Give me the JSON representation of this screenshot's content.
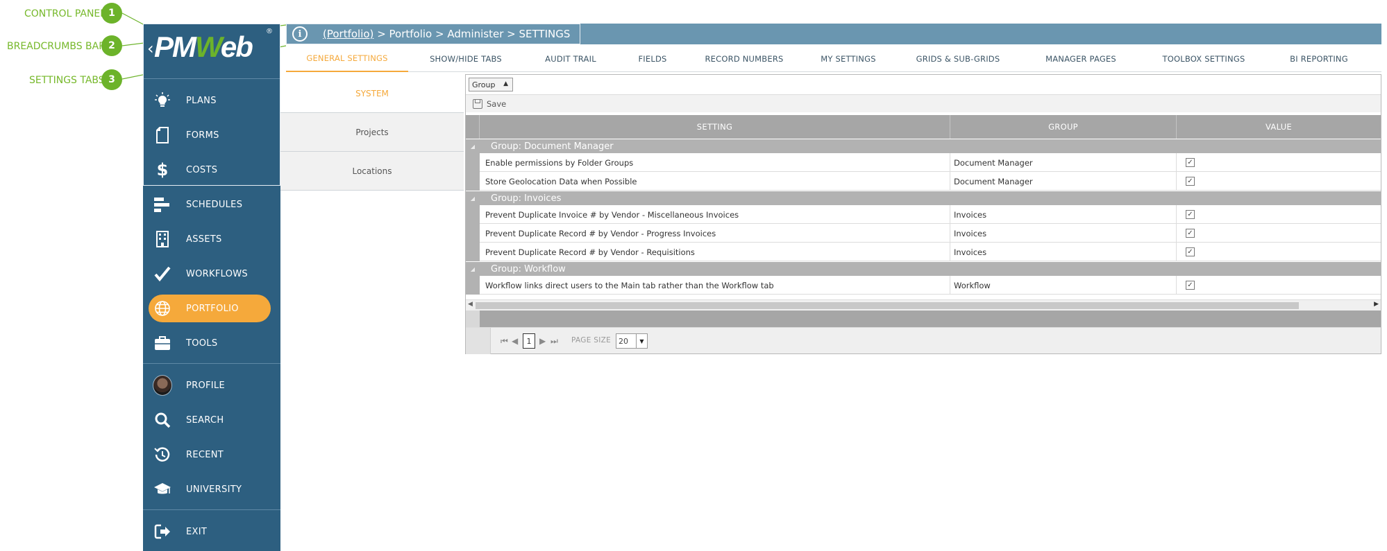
{
  "annotations": [
    {
      "num": "1",
      "label": "CONTROL PANEL"
    },
    {
      "num": "2",
      "label": "BREADCRUMBS BAR"
    },
    {
      "num": "3",
      "label": "SETTINGS TABS"
    }
  ],
  "brand": {
    "logo_pm": "PM",
    "logo_w": "W",
    "logo_eb": "eb",
    "registered": "®",
    "accent": "#f5a93b",
    "green": "#6cb32a",
    "sidebar_bg": "#2d5f80"
  },
  "sidebar": {
    "items": [
      {
        "label": "PLANS",
        "icon": "lightbulb-icon"
      },
      {
        "label": "FORMS",
        "icon": "document-icon"
      },
      {
        "label": "COSTS",
        "icon": "dollar-icon"
      },
      {
        "label": "SCHEDULES",
        "icon": "gantt-icon"
      },
      {
        "label": "ASSETS",
        "icon": "building-icon"
      },
      {
        "label": "WORKFLOWS",
        "icon": "checkmark-icon"
      },
      {
        "label": "PORTFOLIO",
        "icon": "globe-icon"
      },
      {
        "label": "TOOLS",
        "icon": "briefcase-icon"
      },
      {
        "label": "PROFILE",
        "icon": "avatar"
      },
      {
        "label": "SEARCH",
        "icon": "search-icon"
      },
      {
        "label": "RECENT",
        "icon": "history-icon"
      },
      {
        "label": "UNIVERSITY",
        "icon": "graduation-cap-icon"
      },
      {
        "label": "EXIT",
        "icon": "exit-icon"
      }
    ]
  },
  "breadcrumb": {
    "info_glyph": "i",
    "root": "(Portfolio)",
    "rest": " > Portfolio > Administer > SETTINGS"
  },
  "tabs": [
    "GENERAL SETTINGS",
    "SHOW/HIDE TABS",
    "AUDIT TRAIL",
    "FIELDS",
    "RECORD NUMBERS",
    "MY SETTINGS",
    "GRIDS & SUB-GRIDS",
    "MANAGER PAGES",
    "TOOLBOX SETTINGS",
    "BI REPORTING"
  ],
  "subtabs": [
    "SYSTEM",
    "Projects",
    "Locations"
  ],
  "grid": {
    "group_select": "Group",
    "save_label": "Save",
    "columns": [
      "SETTING",
      "GROUP",
      "VALUE"
    ],
    "groups": [
      {
        "label": "Group: Document Manager",
        "rows": [
          {
            "setting": "Enable permissions by Folder Groups",
            "group": "Document Manager",
            "value": true
          },
          {
            "setting": "Store Geolocation Data when Possible",
            "group": "Document Manager",
            "value": true
          }
        ]
      },
      {
        "label": "Group: Invoices",
        "rows": [
          {
            "setting": "Prevent Duplicate Invoice # by Vendor - Miscellaneous Invoices",
            "group": "Invoices",
            "value": true
          },
          {
            "setting": "Prevent Duplicate Record # by Vendor - Progress Invoices",
            "group": "Invoices",
            "value": true
          },
          {
            "setting": "Prevent Duplicate Record # by Vendor - Requisitions",
            "group": "Invoices",
            "value": true
          }
        ]
      },
      {
        "label": "Group: Workflow",
        "rows": [
          {
            "setting": "Workflow links direct users to the Main tab rather than the Workflow tab",
            "group": "Workflow",
            "value": true
          }
        ]
      }
    ],
    "pager": {
      "current_page": "1",
      "page_size_label": "PAGE SIZE",
      "page_size": "20"
    }
  }
}
